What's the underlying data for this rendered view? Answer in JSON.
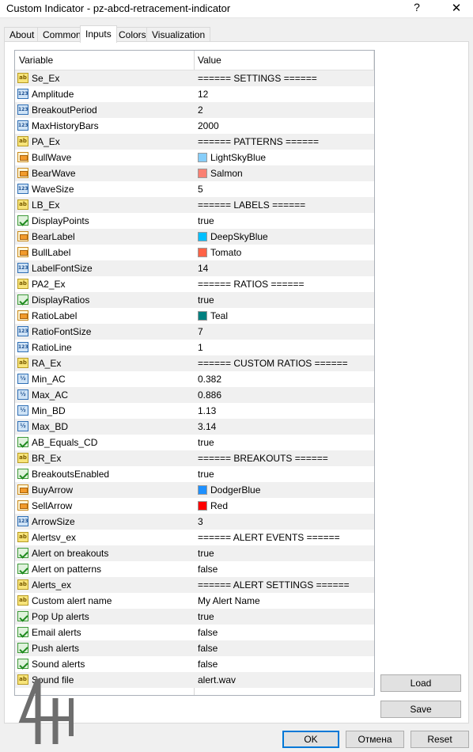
{
  "window": {
    "title": "Custom Indicator - pz-abcd-retracement-indicator",
    "help_label": "?",
    "close_label": "✕"
  },
  "tabs": [
    {
      "label": "About",
      "active": false
    },
    {
      "label": "Common",
      "active": false
    },
    {
      "label": "Inputs",
      "active": true
    },
    {
      "label": "Colors",
      "active": false
    },
    {
      "label": "Visualization",
      "active": false
    }
  ],
  "grid": {
    "col_variable": "Variable",
    "col_value": "Value",
    "rows": [
      {
        "name": "Se_Ex",
        "type": "str",
        "value": "====== SETTINGS ======"
      },
      {
        "name": "Amplitude",
        "type": "int",
        "value": "12"
      },
      {
        "name": "BreakoutPeriod",
        "type": "int",
        "value": "2"
      },
      {
        "name": "MaxHistoryBars",
        "type": "int",
        "value": "2000"
      },
      {
        "name": "PA_Ex",
        "type": "str",
        "value": "====== PATTERNS  ======"
      },
      {
        "name": "BullWave",
        "type": "color",
        "value": "LightSkyBlue",
        "swatch": "#87cefa"
      },
      {
        "name": "BearWave",
        "type": "color",
        "value": "Salmon",
        "swatch": "#fa8072"
      },
      {
        "name": "WaveSize",
        "type": "int",
        "value": "5"
      },
      {
        "name": "LB_Ex",
        "type": "str",
        "value": "====== LABELS ======"
      },
      {
        "name": "DisplayPoints",
        "type": "bool",
        "value": "true"
      },
      {
        "name": "BearLabel",
        "type": "color",
        "value": "DeepSkyBlue",
        "swatch": "#00bfff"
      },
      {
        "name": "BullLabel",
        "type": "color",
        "value": "Tomato",
        "swatch": "#ff6347"
      },
      {
        "name": "LabelFontSize",
        "type": "int",
        "value": "14"
      },
      {
        "name": "PA2_Ex",
        "type": "str",
        "value": "====== RATIOS ======"
      },
      {
        "name": "DisplayRatios",
        "type": "bool",
        "value": "true"
      },
      {
        "name": "RatioLabel",
        "type": "color",
        "value": "Teal",
        "swatch": "#008080"
      },
      {
        "name": "RatioFontSize",
        "type": "int",
        "value": "7"
      },
      {
        "name": "RatioLine",
        "type": "int",
        "value": "1"
      },
      {
        "name": "RA_Ex",
        "type": "str",
        "value": "====== CUSTOM RATIOS ======"
      },
      {
        "name": "Min_AC",
        "type": "dbl",
        "value": "0.382"
      },
      {
        "name": "Max_AC",
        "type": "dbl",
        "value": "0.886"
      },
      {
        "name": "Min_BD",
        "type": "dbl",
        "value": "1.13"
      },
      {
        "name": "Max_BD",
        "type": "dbl",
        "value": "3.14"
      },
      {
        "name": "AB_Equals_CD",
        "type": "bool",
        "value": "true"
      },
      {
        "name": "BR_Ex",
        "type": "str",
        "value": "====== BREAKOUTS ======"
      },
      {
        "name": "BreakoutsEnabled",
        "type": "bool",
        "value": "true"
      },
      {
        "name": "BuyArrow",
        "type": "color",
        "value": "DodgerBlue",
        "swatch": "#1e90ff"
      },
      {
        "name": "SellArrow",
        "type": "color",
        "value": "Red",
        "swatch": "#ff0000"
      },
      {
        "name": "ArrowSize",
        "type": "int",
        "value": "3"
      },
      {
        "name": "Alertsv_ex",
        "type": "str",
        "value": "====== ALERT EVENTS ======"
      },
      {
        "name": "Alert on breakouts",
        "type": "bool",
        "value": "true"
      },
      {
        "name": "Alert on patterns",
        "type": "bool",
        "value": "false"
      },
      {
        "name": "Alerts_ex",
        "type": "str",
        "value": "====== ALERT SETTINGS ======"
      },
      {
        "name": "Custom alert name",
        "type": "str",
        "value": "My Alert Name"
      },
      {
        "name": "Pop Up alerts",
        "type": "bool",
        "value": "true"
      },
      {
        "name": "Email alerts",
        "type": "bool",
        "value": "false"
      },
      {
        "name": "Push alerts",
        "type": "bool",
        "value": "false"
      },
      {
        "name": "Sound alerts",
        "type": "bool",
        "value": "false"
      },
      {
        "name": "Sound file",
        "type": "str",
        "value": "alert.wav"
      }
    ]
  },
  "icons": {
    "str": "ab",
    "int": "123",
    "dbl": "½"
  },
  "buttons": {
    "load": "Load",
    "save": "Save",
    "ok": "OK",
    "cancel": "Отмена",
    "reset": "Reset"
  }
}
